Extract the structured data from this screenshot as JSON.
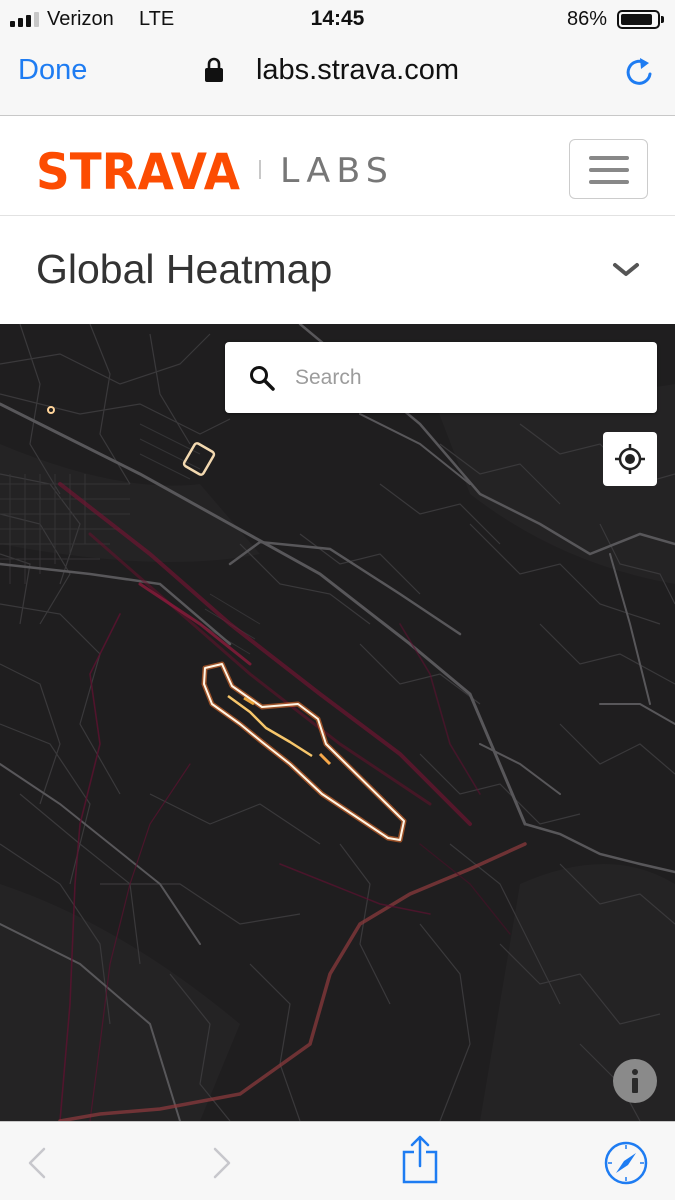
{
  "status": {
    "carrier": "Verizon",
    "network": "LTE",
    "time": "14:45",
    "battery": "86%",
    "battery_level": 0.86,
    "signal_bars": 3
  },
  "browser": {
    "done_label": "Done",
    "url": "labs.strava.com",
    "accent_color": "#1e7cf2"
  },
  "header": {
    "brand": "STRAVA",
    "product": "LABS",
    "brand_color": "#fc4c02"
  },
  "page": {
    "title": "Global Heatmap"
  },
  "map": {
    "search_placeholder": "Search",
    "icons": [
      "search-icon",
      "locate-icon",
      "info-icon"
    ]
  },
  "toolbar": {
    "icons": [
      "back-icon",
      "forward-icon",
      "share-icon",
      "compass-icon"
    ]
  }
}
